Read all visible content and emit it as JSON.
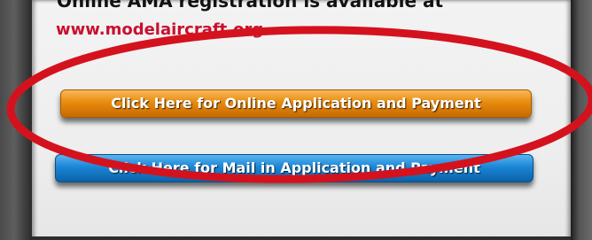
{
  "content": {
    "headline": "Online AMA registration is available at",
    "link_text": "www.modelaircraft.org"
  },
  "buttons": {
    "online_label": "Click Here for Online Application and Payment",
    "mail_label": "Click Here for Mail in Application and Payment"
  },
  "colors": {
    "link": "#c8102e",
    "online_button": "#e88b0d",
    "mail_button": "#1a86d6",
    "annotation_circle": "#d4121e"
  }
}
